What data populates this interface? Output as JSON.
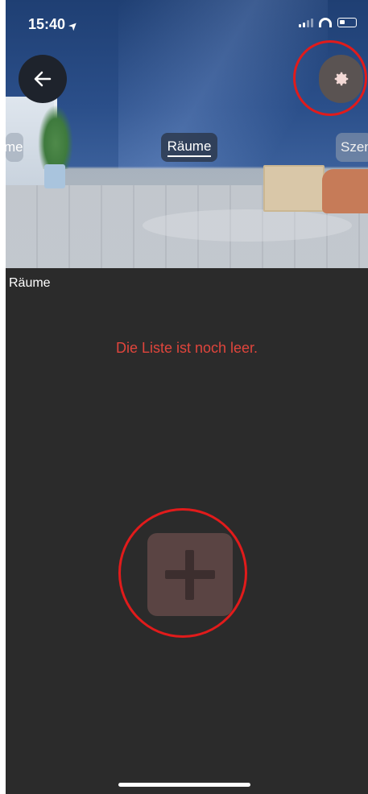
{
  "status_bar": {
    "time": "15:40",
    "location_glyph": "➤",
    "icons": [
      "signal-icon",
      "wifi-icon",
      "battery-icon"
    ]
  },
  "header": {
    "back_icon": "←",
    "settings_icon": "✹"
  },
  "tabs": [
    {
      "label": "me"
    },
    {
      "label": "Räume",
      "selected": true
    },
    {
      "label": "Szen"
    }
  ],
  "section": {
    "title": "Räume",
    "empty_message": "Die Liste ist noch leer."
  },
  "colors": {
    "accent_red": "#e11b1b",
    "message_red": "#e0453c",
    "background_dark": "#2b2b2b"
  }
}
